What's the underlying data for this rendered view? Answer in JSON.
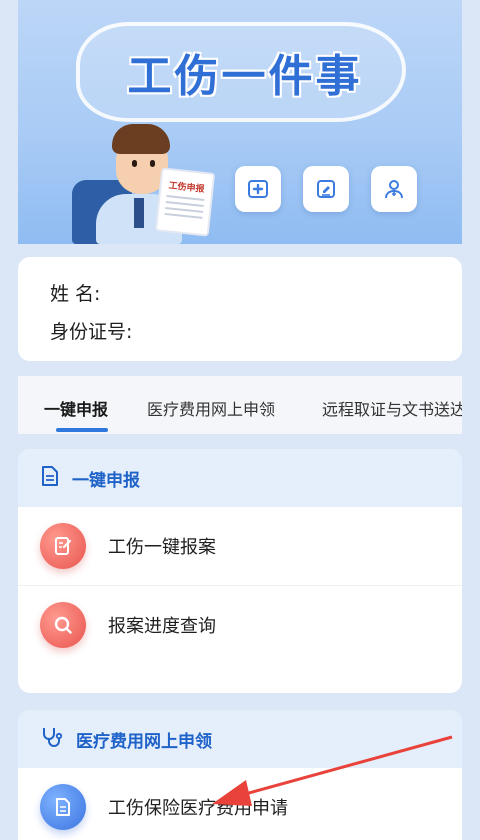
{
  "banner": {
    "title": "工伤一件事",
    "clipboard_text": "工伤申报",
    "icons": [
      "medical-cross-icon",
      "edit-document-icon",
      "doctor-icon"
    ]
  },
  "info": {
    "name_label": "姓  名:",
    "id_label": "身份证号:"
  },
  "tabs": [
    {
      "label": "一键申报",
      "active": true
    },
    {
      "label": "医疗费用网上申领",
      "active": false
    },
    {
      "label": "远程取证与文书送达",
      "active": false
    }
  ],
  "sections": [
    {
      "title": "一键申报",
      "icon": "document-icon",
      "items": [
        {
          "label": "工伤一键报案",
          "icon": "report-icon",
          "color": "#e8544d"
        },
        {
          "label": "报案进度查询",
          "icon": "search-icon",
          "color": "#e8544d"
        }
      ]
    },
    {
      "title": "医疗费用网上申领",
      "icon": "stethoscope-icon",
      "items": [
        {
          "label": "工伤保险医疗费用申请",
          "icon": "document-icon",
          "color": "#3a73df"
        }
      ]
    }
  ],
  "colors": {
    "accent": "#2f79de",
    "section_title": "#1f63c9",
    "annotation_arrow": "#e8423a"
  }
}
